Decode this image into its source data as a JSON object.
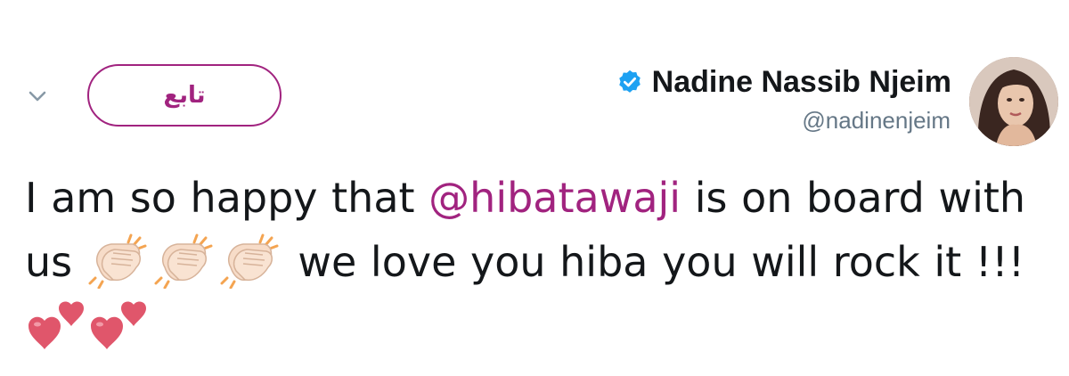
{
  "author": {
    "display_name": "Nadine Nassib Njeim",
    "handle": "@nadinenjeim",
    "verified": true
  },
  "follow_button": {
    "label": "تابع"
  },
  "tweet": {
    "text_part1": "I am so happy that ",
    "mention": "@hibatawaji",
    "text_part2": " is on board with us ",
    "text_part3": " we love you hiba you will rock it !!! ",
    "emojis": [
      "clapping-hands",
      "clapping-hands",
      "clapping-hands",
      "two-hearts",
      "two-hearts"
    ]
  },
  "colors": {
    "accent": "#a1237f",
    "verified_badge": "#1da1f2",
    "handle": "#657786",
    "text": "#14171a",
    "heart": "#e0566b"
  }
}
